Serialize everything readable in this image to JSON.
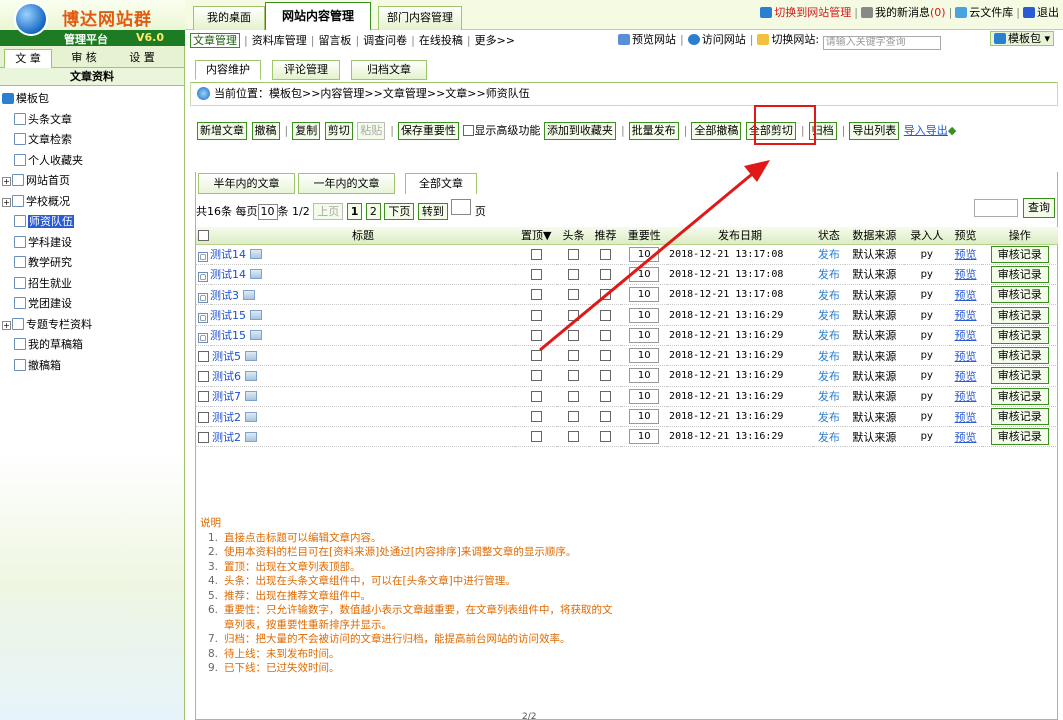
{
  "logo": {
    "name": "博达网站群",
    "sub": "管理平台",
    "version": "V6.0"
  },
  "top_tabs": [
    "我的桌面",
    "网站内容管理",
    "部门内容管理"
  ],
  "top_right": {
    "switch": "切换到网站管理",
    "messages": "我的新消息",
    "msg_count": "(0)",
    "cloud": "云文件库",
    "logout": "退出"
  },
  "sub_nav": [
    "文章管理",
    "资料库管理",
    "留言板",
    "调查问卷",
    "在线投稿",
    "更多>>"
  ],
  "sub_right": {
    "preview": "预览网站",
    "visit": "访问网站",
    "switch_site": "切换网站:",
    "keyword_placeholder": "请输入关键字查询",
    "template_pack": "模板包"
  },
  "side_tabs": [
    "文 章",
    "审 核",
    "设 置"
  ],
  "side_title": "文章资料",
  "tree": {
    "root": "模板包",
    "items": [
      {
        "label": "头条文章",
        "expand": false
      },
      {
        "label": "文章检索",
        "expand": false
      },
      {
        "label": "个人收藏夹",
        "expand": false
      },
      {
        "label": "网站首页",
        "expand": true
      },
      {
        "label": "学校概况",
        "expand": true
      },
      {
        "label": "师资队伍",
        "expand": false,
        "selected": true
      },
      {
        "label": "学科建设",
        "expand": false
      },
      {
        "label": "教学研究",
        "expand": false
      },
      {
        "label": "招生就业",
        "expand": false
      },
      {
        "label": "党团建设",
        "expand": false
      },
      {
        "label": "专题专栏资料",
        "expand": true
      },
      {
        "label": "我的草稿箱",
        "expand": false
      },
      {
        "label": "撤稿箱",
        "expand": false
      }
    ]
  },
  "content_tabs": [
    "内容维护",
    "评论管理",
    "归档文章"
  ],
  "breadcrumb": "当前位置：模板包>>内容管理>>文章管理>>文章>>师资队伍",
  "toolbar": {
    "new": "新增文章",
    "withdraw": "撤稿",
    "copy": "复制",
    "cut": "剪切",
    "paste": "粘贴",
    "save_imp": "保存重要性",
    "advanced": "显示高级功能",
    "add_fav": "添加到收藏夹",
    "batch_pub": "批量发布",
    "withdraw_all": "全部撤稿",
    "cut_all": "全部剪切",
    "archive": "归档",
    "export_list": "导出列表",
    "import_export": "导入导出"
  },
  "filter_tabs": [
    "半年内的文章",
    "一年内的文章",
    "全部文章"
  ],
  "pager": {
    "total": "共16条",
    "per_page_label": "每页",
    "per_page": "10",
    "unit": "条",
    "page_info": "1/2",
    "prev": "上页",
    "p1": "1",
    "p2": "2",
    "next": "下页",
    "goto": "转到",
    "page": "页",
    "search": "查询"
  },
  "table": {
    "headers": [
      "标题",
      "置顶▼",
      "头条",
      "推荐",
      "重要性",
      "发布日期",
      "状态",
      "数据来源",
      "录入人",
      "预览",
      "操作"
    ],
    "rows": [
      {
        "title": "测试14",
        "exp": true,
        "imp": "10",
        "date": "2018-12-21 13:17:08",
        "status": "发布",
        "source": "默认来源",
        "user": "py",
        "preview": "预览",
        "op": "审核记录"
      },
      {
        "title": "测试14",
        "exp": true,
        "imp": "10",
        "date": "2018-12-21 13:17:08",
        "status": "发布",
        "source": "默认来源",
        "user": "py",
        "preview": "预览",
        "op": "审核记录"
      },
      {
        "title": "测试3",
        "exp": true,
        "imp": "10",
        "date": "2018-12-21 13:17:08",
        "status": "发布",
        "source": "默认来源",
        "user": "py",
        "preview": "预览",
        "op": "审核记录"
      },
      {
        "title": "测试15",
        "exp": true,
        "imp": "10",
        "date": "2018-12-21 13:16:29",
        "status": "发布",
        "source": "默认来源",
        "user": "py",
        "preview": "预览",
        "op": "审核记录"
      },
      {
        "title": "测试15",
        "exp": true,
        "imp": "10",
        "date": "2018-12-21 13:16:29",
        "status": "发布",
        "source": "默认来源",
        "user": "py",
        "preview": "预览",
        "op": "审核记录"
      },
      {
        "title": "测试5",
        "exp": false,
        "imp": "10",
        "date": "2018-12-21 13:16:29",
        "status": "发布",
        "source": "默认来源",
        "user": "py",
        "preview": "预览",
        "op": "审核记录"
      },
      {
        "title": "测试6",
        "exp": false,
        "imp": "10",
        "date": "2018-12-21 13:16:29",
        "status": "发布",
        "source": "默认来源",
        "user": "py",
        "preview": "预览",
        "op": "审核记录"
      },
      {
        "title": "测试7",
        "exp": false,
        "imp": "10",
        "date": "2018-12-21 13:16:29",
        "status": "发布",
        "source": "默认来源",
        "user": "py",
        "preview": "预览",
        "op": "审核记录"
      },
      {
        "title": "测试2",
        "exp": false,
        "imp": "10",
        "date": "2018-12-21 13:16:29",
        "status": "发布",
        "source": "默认来源",
        "user": "py",
        "preview": "预览",
        "op": "审核记录"
      },
      {
        "title": "测试2",
        "exp": false,
        "imp": "10",
        "date": "2018-12-21 13:16:29",
        "status": "发布",
        "source": "默认来源",
        "user": "py",
        "preview": "预览",
        "op": "审核记录"
      }
    ]
  },
  "notes": {
    "head": "说明",
    "items": [
      "直接点击标题可以编辑文章内容。",
      "使用本资料的栏目可在[资料来源]处通过[内容排序]来调整文章的显示顺序。",
      "置顶：出现在文章列表顶部。",
      "头条：出现在头条文章组件中，可以在[头条文章]中进行管理。",
      "推荐：出现在推荐文章组件中。",
      "重要性：只允许输数字，数值越小表示文章越重要，在文章列表组件中，将获取的文",
      "章列表，按重要性重新排序并显示。",
      "归档：把大量的不会被访问的文章进行归档，能提高前台网站的访问效率。",
      "待上线：未到发布时间。",
      "已下线：已过失效时间。"
    ],
    "numbers": [
      "1.",
      "2.",
      "3.",
      "4.",
      "5.",
      "6.",
      "",
      "7.",
      "8.",
      "9."
    ]
  },
  "bottom_hint": "2/2",
  "colors": {
    "accent_green": "#3b8f1e",
    "highlight_red": "#e01818",
    "link_blue": "#1a4ed1",
    "note_orange": "#e06a00"
  }
}
